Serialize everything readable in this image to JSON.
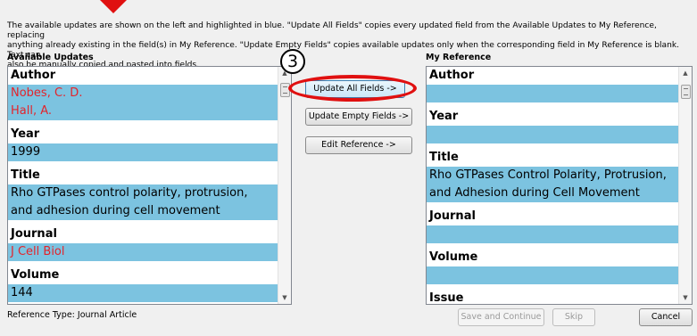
{
  "instructions": {
    "line1": "The available updates are shown on the left and highlighted in blue. \"Update All Fields\" copies every updated field from the Available Updates to My Reference, replacing",
    "line2": "anything already existing in the field(s) in My Reference. \"Update Empty Fields\" copies available updates only when the corresponding field in My Reference is blank. Text can",
    "line3": "also be manually copied and pasted into fields."
  },
  "available_updates": {
    "title": "Available Updates",
    "fields": [
      {
        "label": "Author",
        "lines": [
          "Nobes, C. D.",
          "Hall, A."
        ],
        "color": "#e3242b"
      },
      {
        "label": "Year",
        "lines": [
          "1999"
        ]
      },
      {
        "label": "Title",
        "lines": [
          "Rho GTPases control polarity, protrusion,",
          "and adhesion during cell movement"
        ]
      },
      {
        "label": "Journal",
        "lines": [
          "J Cell Biol"
        ],
        "color": "#e3242b"
      },
      {
        "label": "Volume",
        "lines": [
          "144"
        ]
      }
    ]
  },
  "my_reference": {
    "title": "My Reference",
    "fields": [
      {
        "label": "Author",
        "lines": [
          ""
        ]
      },
      {
        "label": "Year",
        "lines": [
          ""
        ]
      },
      {
        "label": "Title",
        "lines": [
          "Rho GTPases Control Polarity, Protrusion,",
          "and Adhesion during Cell Movement"
        ]
      },
      {
        "label": "Journal",
        "lines": [
          ""
        ]
      },
      {
        "label": "Volume",
        "lines": [
          ""
        ]
      },
      {
        "label": "Issue",
        "lines": [
          ""
        ]
      }
    ]
  },
  "actions": {
    "update_all": "Update All Fields ->",
    "update_empty": "Update Empty Fields ->",
    "edit_reference": "Edit Reference ->"
  },
  "annotation": {
    "step_number": "3",
    "highlight_color": "#e01010"
  },
  "footer": {
    "reference_type": "Reference Type: Journal Article",
    "save_continue": "Save and Continue",
    "skip": "Skip",
    "cancel": "Cancel"
  },
  "colors": {
    "field_highlight": "#7cc3e0",
    "updated_text": "#e3242b"
  }
}
